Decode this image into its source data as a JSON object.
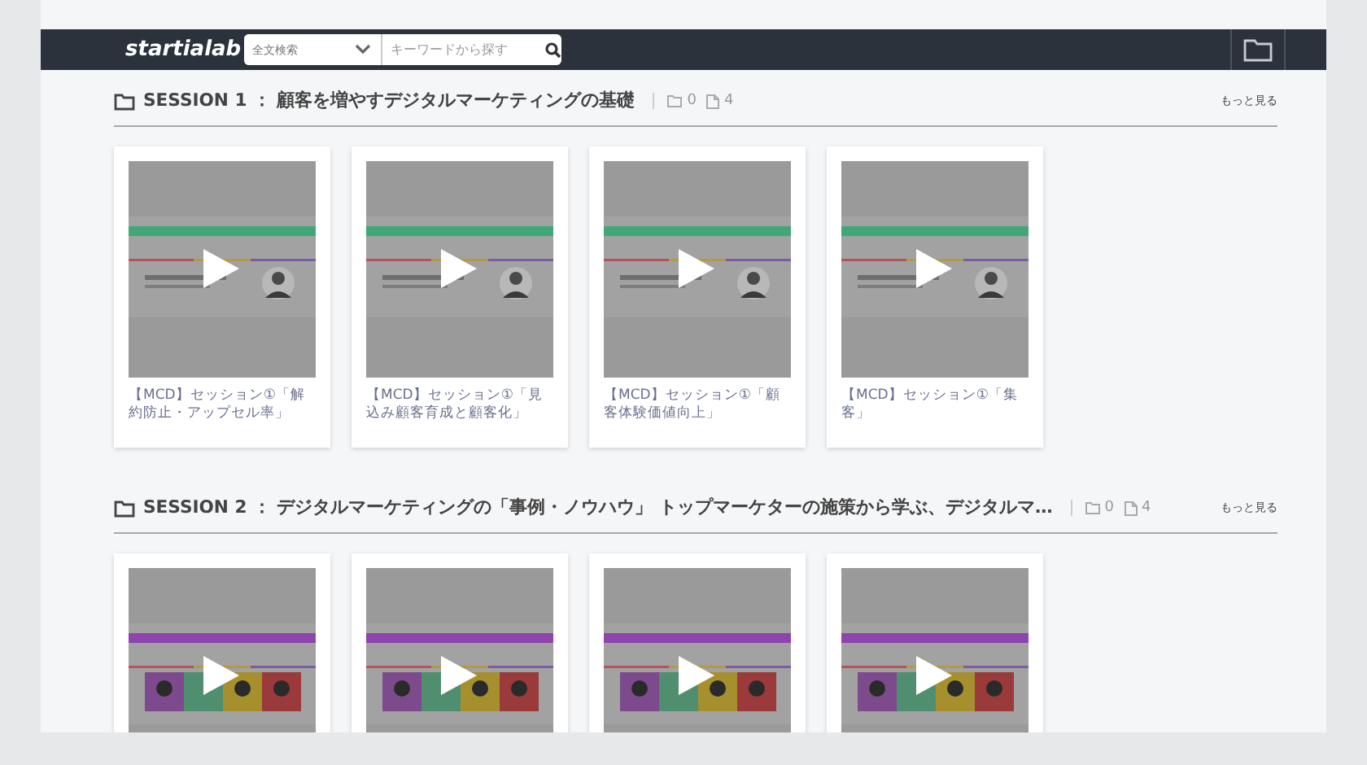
{
  "header": {
    "logo": "startialab",
    "search_mode": "全文検索",
    "search": {
      "placeholder": "キーワードから探す"
    }
  },
  "sections": [
    {
      "title": "SESSION 1 ： 顧客を増やすデジタルマーケティングの基礎",
      "folders": "0",
      "files": "4",
      "more": "もっと見る",
      "cards": [
        {
          "kind": "picture",
          "title": "【MCD】セッション①「解約防止・アップセル率」"
        },
        {
          "kind": "picture",
          "title": "【MCD】セッション①「見込み顧客育成と顧客化」"
        },
        {
          "kind": "picture",
          "title": "【MCD】セッション①「顧客体験価値向上」"
        },
        {
          "kind": "picture",
          "title": "【MCD】セッション①「集客」"
        }
      ]
    },
    {
      "title": "SESSION 2 ： デジタルマーケティングの「事例・ノウハウ」 トップマーケターの施策から学ぶ、デジタルマ…",
      "folders": "0",
      "files": "4",
      "more": "もっと見る"
    }
  ]
}
